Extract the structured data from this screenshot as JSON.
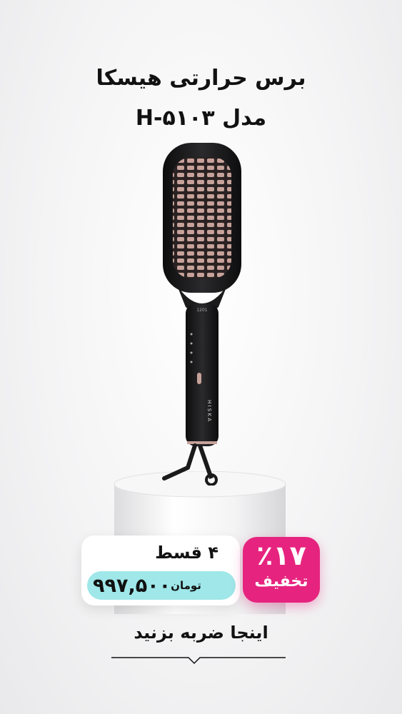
{
  "product": {
    "title_line1": "برس حرارتی هیسکا",
    "title_line2": "مدل H-۵۱۰۳",
    "brand_on_device": "H I S K A"
  },
  "price": {
    "installments": "۴ قسط",
    "amount": "۹۹۷,۵۰۰",
    "currency": "تومان"
  },
  "discount": {
    "percent": "٪۱۷",
    "label": "تخفیف"
  },
  "cta": {
    "label": "اینجا ضربه بزنید",
    "icon": "chevron-down-icon"
  },
  "colors": {
    "discount_bg": "#e6247f",
    "price_pill_bg": "#9fe7e9",
    "brush_body": "#1b1b1c",
    "brush_accent": "#c7a29a"
  }
}
